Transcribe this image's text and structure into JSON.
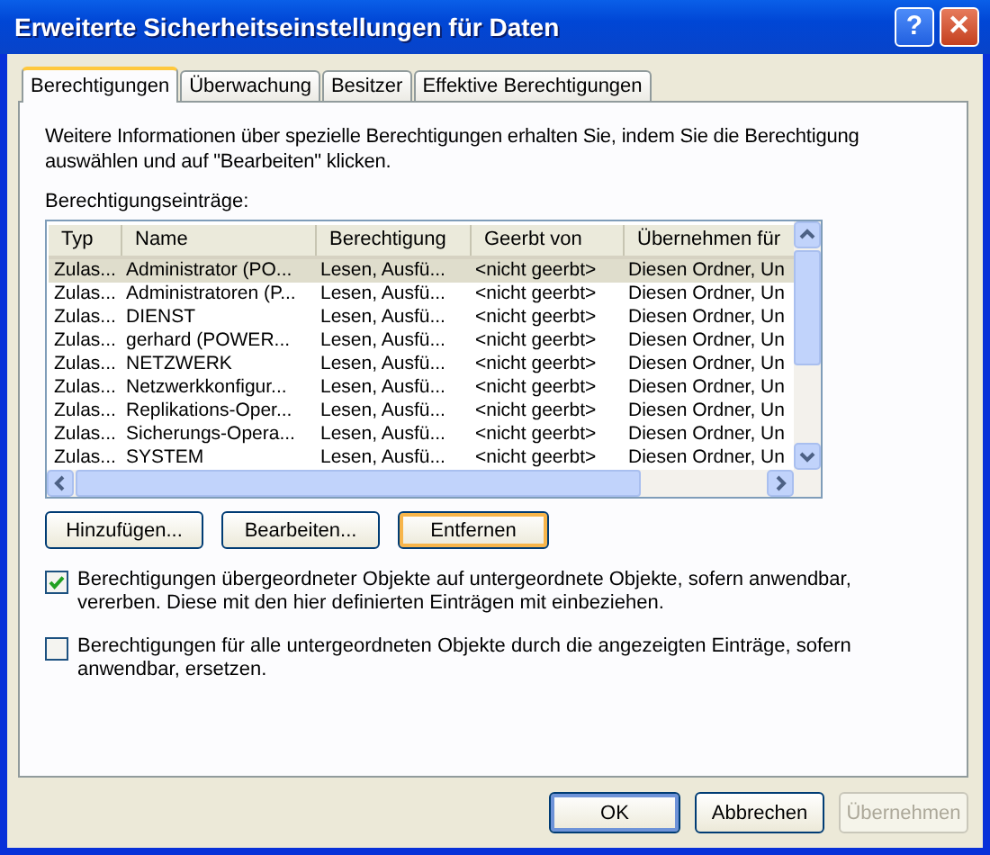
{
  "window": {
    "title": "Erweiterte Sicherheitseinstellungen für Daten"
  },
  "title_buttons": [
    {
      "kind": "help",
      "label": "?"
    },
    {
      "kind": "close",
      "label": "✕"
    }
  ],
  "tabs": [
    {
      "label": "Berechtigungen",
      "selected": true
    },
    {
      "label": "Überwachung",
      "selected": false
    },
    {
      "label": "Besitzer",
      "selected": false
    },
    {
      "label": "Effektive Berechtigungen",
      "selected": false
    }
  ],
  "info_text": "Weitere Informationen über spezielle Berechtigungen erhalten Sie, indem Sie die Berechtigung auswählen und auf \"Bearbeiten\" klicken.",
  "list_label": "Berechtigungseinträge:",
  "table": {
    "columns": [
      "Typ",
      "Name",
      "Berechtigung",
      "Geerbt von",
      "Übernehmen für"
    ],
    "rows": [
      {
        "cells": [
          "Zulas...",
          "Administrator (PO...",
          "Lesen, Ausfü...",
          "<nicht geerbt>",
          "Diesen Ordner, Un"
        ],
        "selected": true
      },
      {
        "cells": [
          "Zulas...",
          "Administratoren (P...",
          "Lesen, Ausfü...",
          "<nicht geerbt>",
          "Diesen Ordner, Un"
        ],
        "selected": false
      },
      {
        "cells": [
          "Zulas...",
          "DIENST",
          "Lesen, Ausfü...",
          "<nicht geerbt>",
          "Diesen Ordner, Un"
        ],
        "selected": false
      },
      {
        "cells": [
          "Zulas...",
          "gerhard (POWER...",
          "Lesen, Ausfü...",
          "<nicht geerbt>",
          "Diesen Ordner, Un"
        ],
        "selected": false
      },
      {
        "cells": [
          "Zulas...",
          "NETZWERK",
          "Lesen, Ausfü...",
          "<nicht geerbt>",
          "Diesen Ordner, Un"
        ],
        "selected": false
      },
      {
        "cells": [
          "Zulas...",
          "Netzwerkkonfigur...",
          "Lesen, Ausfü...",
          "<nicht geerbt>",
          "Diesen Ordner, Un"
        ],
        "selected": false
      },
      {
        "cells": [
          "Zulas...",
          "Replikations-Oper...",
          "Lesen, Ausfü...",
          "<nicht geerbt>",
          "Diesen Ordner, Un"
        ],
        "selected": false
      },
      {
        "cells": [
          "Zulas...",
          "Sicherungs-Opera...",
          "Lesen, Ausfü...",
          "<nicht geerbt>",
          "Diesen Ordner, Un"
        ],
        "selected": false
      },
      {
        "cells": [
          "Zulas...",
          "SYSTEM",
          "Lesen, Ausfü...",
          "<nicht geerbt>",
          "Diesen Ordner, Un"
        ],
        "selected": false
      }
    ]
  },
  "list_buttons": [
    {
      "label": "Hinzufügen...",
      "focused": false
    },
    {
      "label": "Bearbeiten...",
      "focused": false
    },
    {
      "label": "Entfernen",
      "focused": true
    }
  ],
  "options": [
    {
      "label": "Berechtigungen übergeordneter Objekte auf untergeordnete Objekte, sofern anwendbar, vererben. Diese mit den hier definierten Einträgen mit einbeziehen.",
      "checked": true
    },
    {
      "label": "Berechtigungen für alle untergeordneten Objekte durch die angezeigten Einträge, sofern anwendbar, ersetzen.",
      "checked": false
    }
  ],
  "buttons": [
    {
      "label": "OK",
      "default": true,
      "disabled": false
    },
    {
      "label": "Abbrechen",
      "default": false,
      "disabled": false
    },
    {
      "label": "Übernehmen",
      "default": false,
      "disabled": true
    }
  ]
}
